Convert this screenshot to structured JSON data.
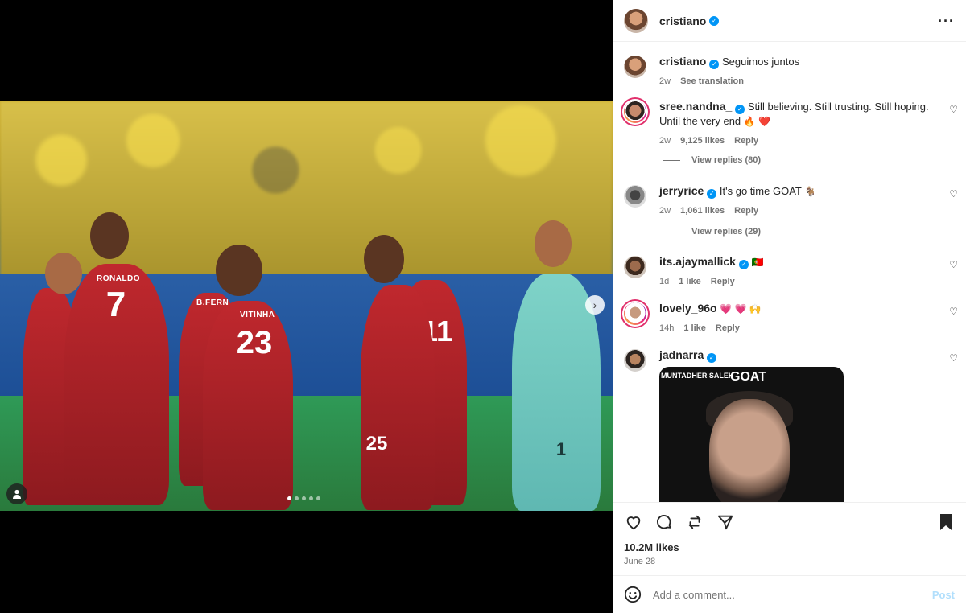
{
  "post": {
    "author": "cristiano",
    "caption": "Seguimos juntos",
    "caption_time": "2w",
    "see_translation": "See translation",
    "likes": "10.2M likes",
    "date": "June 28",
    "carousel_count": 5,
    "carousel_active": 0
  },
  "photo": {
    "num_7": "7",
    "name_7": "RONALDO",
    "num_23": "23",
    "name_23": "VITINHA",
    "num_11": "11",
    "num_25": "25",
    "name_bf": "B.FERN",
    "num_1": "1"
  },
  "comments": [
    {
      "user": "sree.nandna_",
      "verified": true,
      "text": "Still believing. Still trusting. Still hoping. Until the very end",
      "emoji": "🔥 ❤️",
      "time": "2w",
      "likes": "9,125 likes",
      "reply": "Reply",
      "view_replies": "View replies (80)"
    },
    {
      "user": "jerryrice",
      "verified": true,
      "text": "It's go time GOAT",
      "emoji": "🐐",
      "time": "2w",
      "likes": "1,061 likes",
      "reply": "Reply",
      "view_replies": "View replies (29)"
    },
    {
      "user": "its.ajaymallick",
      "verified": true,
      "text": "",
      "emoji": "🇵🇹",
      "time": "1d",
      "likes": "1 like",
      "reply": "Reply"
    },
    {
      "user": "lovely_96o",
      "verified": false,
      "text": "",
      "emoji": "💗 💗 🙌",
      "time": "14h",
      "likes": "1 like",
      "reply": "Reply"
    },
    {
      "user": "jadnarra",
      "verified": true,
      "text": "",
      "emoji": "",
      "image_label_top": "GOAT",
      "image_label_side": "MUNTADHER SALEH"
    }
  ],
  "add_comment": {
    "placeholder": "Add a comment...",
    "post_label": "Post"
  },
  "colors": {
    "verified": "#0095f6",
    "post_button": "#b2dffc",
    "text": "#262626",
    "muted": "#737373"
  }
}
